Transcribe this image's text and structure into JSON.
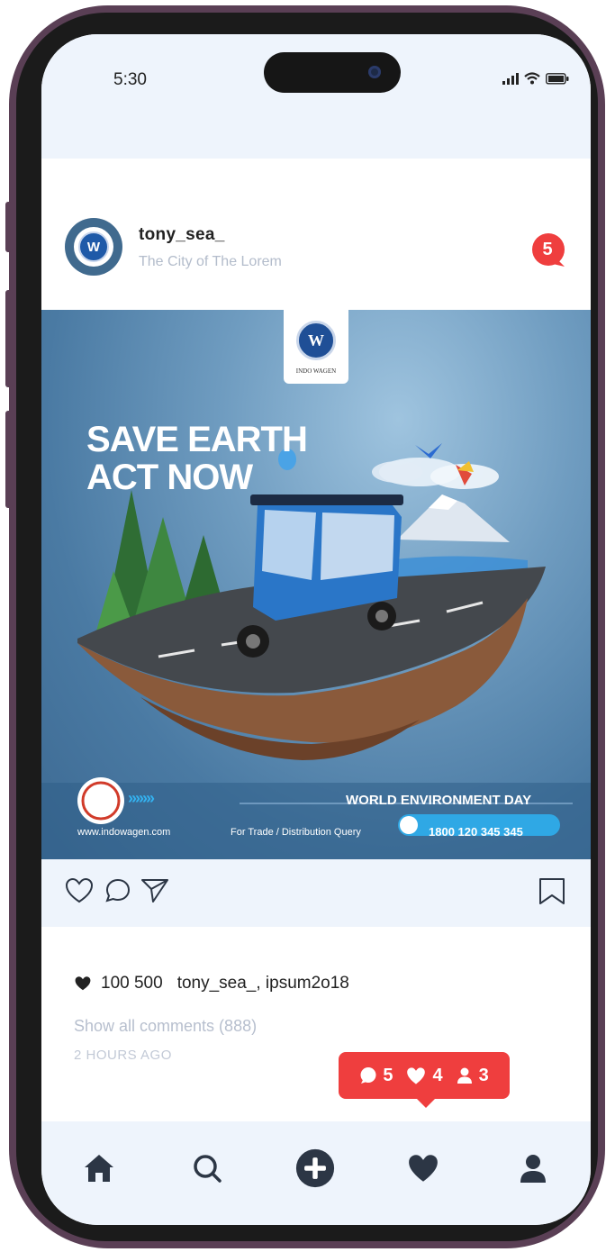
{
  "status_bar": {
    "time": "5:30"
  },
  "post": {
    "username": "tony_sea_",
    "location": "The City of The Lorem",
    "message_badge_count": "5",
    "likes_count": "100 500",
    "liked_by": "tony_sea_, ipsum2o18",
    "show_comments": "Show all comments (888)",
    "time_ago": "2 HOURS AGO"
  },
  "post_image": {
    "brand": "INDO WAGEN",
    "headline_line1": "SAVE EARTH",
    "headline_line2": "ACT NOW",
    "event": "WORLD ENVIRONMENT DAY",
    "website": "www.indowagen.com",
    "query_label": "For Trade / Distribution Query",
    "phone": "1800 120 345 345",
    "arrows": "›››››››"
  },
  "notification": {
    "comments": "5",
    "likes": "4",
    "followers": "3"
  },
  "colors": {
    "accent_red": "#ef3e3e",
    "bar_bg": "#eef4fc",
    "icon_dark": "#2c3645",
    "frame": "#5a3f55"
  }
}
